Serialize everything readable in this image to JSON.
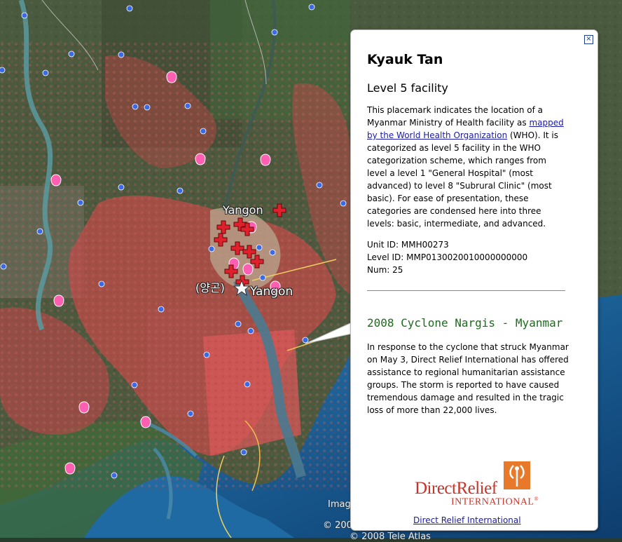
{
  "map": {
    "labels": [
      {
        "text": "Yangon",
        "type": "city"
      },
      {
        "text": "(양곤)",
        "type": "city-alt"
      },
      {
        "text": "Yangon",
        "type": "city-primary"
      }
    ],
    "copyright": [
      "Imag",
      "© 200",
      "© 2008 Tele Atlas"
    ]
  },
  "balloon": {
    "close_label": "×",
    "title": "Kyauk Tan",
    "subtitle": "Level 5 facility",
    "desc_before": "This placemark indicates the location of a Myanmar Ministry of Health facility as ",
    "desc_link": "mapped by the World Health Organization",
    "desc_after": " (WHO). It is categorized as level 5 facility in the WHO categorization scheme, which ranges from level a level 1 \"General Hospital\" (most advanced) to level 8 \"Subrural Clinic\" (most basic). For ease of presentation, these categories are condensed here into three levels: basic, intermediate, and advanced.",
    "unit_id": "Unit ID: MMH00273",
    "level_id": "Level ID: MMP0130020010000000000",
    "num": "Num: 25",
    "section_title": "2008 Cyclone Nargis - Myanmar",
    "section_text": "In response to the cyclone that struck Myanmar on May 3, Direct Relief International has offered assistance to regional humanitarian assistance groups. The storm is reported to have caused tremendous damage and resulted in the tragic loss of more than 22,000 lives.",
    "logo_line1": "DirectRelief",
    "logo_line2": "INTERNATIONAL",
    "logo_mark": "®",
    "link": "Direct Relief International"
  },
  "colors": {
    "title_green": "#1c6b1c",
    "link_blue": "#1a1aa8",
    "logo_red": "#c8342a",
    "logo_orange": "#e8782a",
    "flood_red": "#c84a4a",
    "water": "#1e6fa8"
  }
}
